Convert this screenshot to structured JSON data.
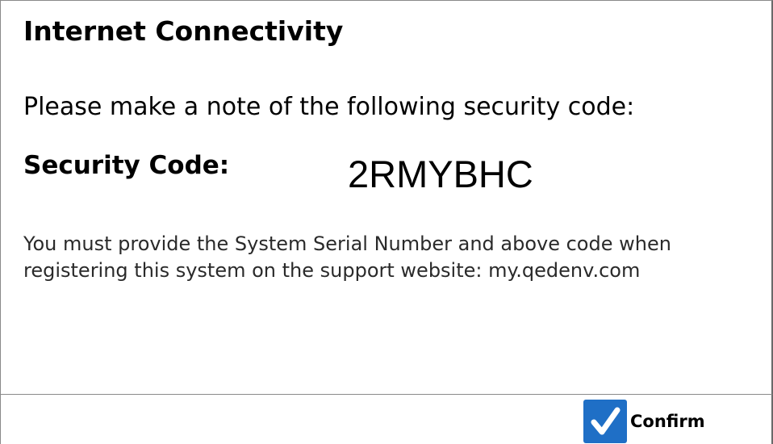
{
  "dialog": {
    "title": "Internet Connectivity",
    "instruction": "Please make a note of the following security code:",
    "code_label": "Security Code:",
    "code_value": "2RMYBHC",
    "message": "You must provide the System Serial Number and above code when registering this system on the support website: my.qedenv.com",
    "confirm_label": "Confirm",
    "confirm_icon": "checkmark-icon"
  },
  "colors": {
    "confirm_icon_background": "#1f6fc6",
    "confirm_icon_check": "#ffffff",
    "border": "#8a8a8a"
  }
}
